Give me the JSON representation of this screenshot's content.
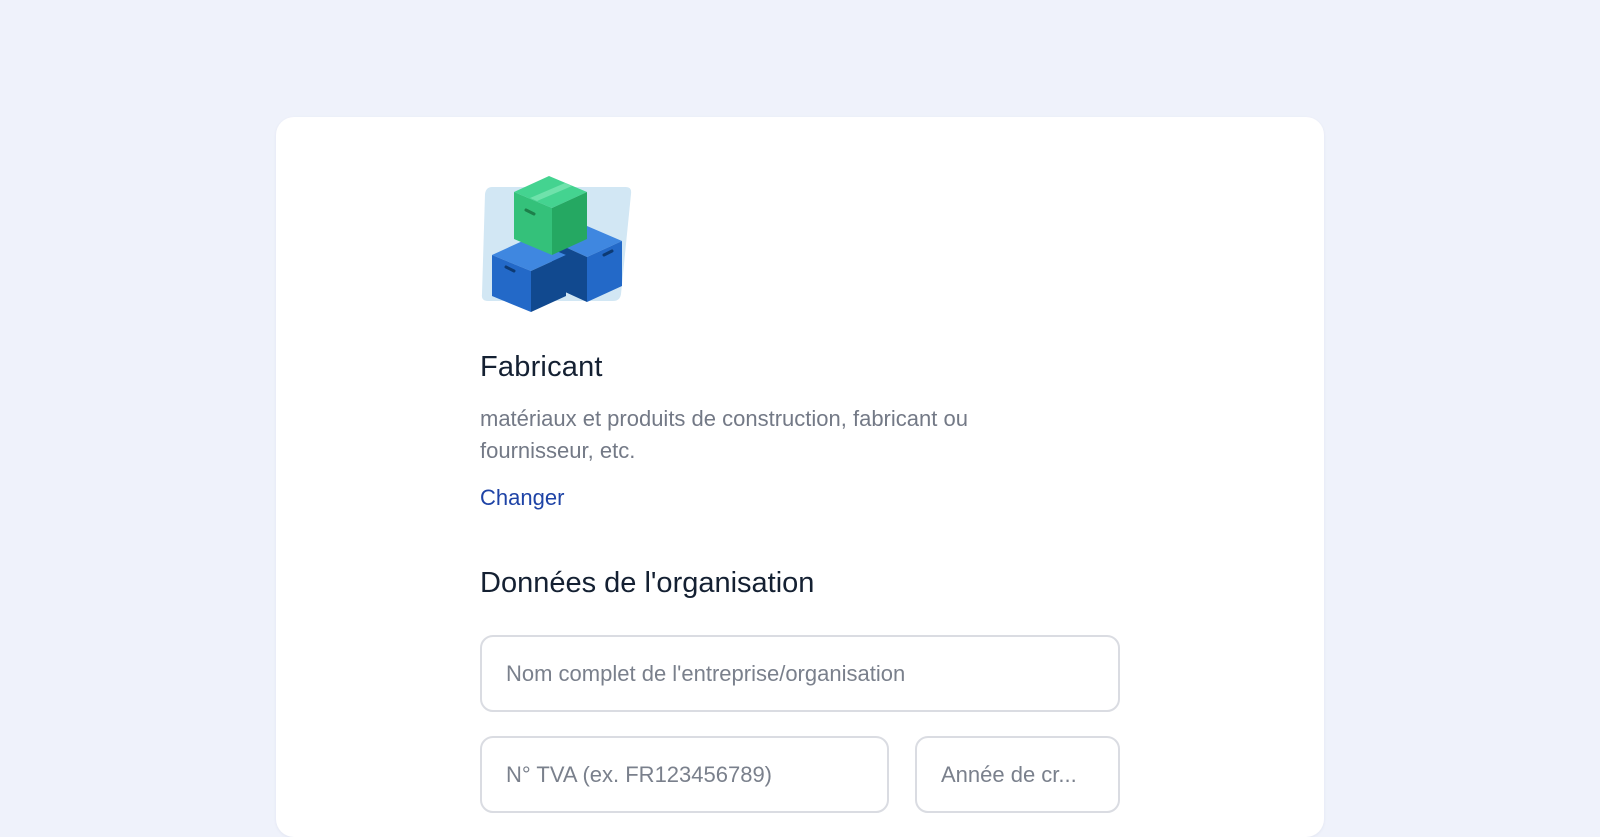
{
  "category": {
    "icon": "stacked-boxes-icon",
    "title": "Fabricant",
    "description": "matériaux et produits de construction, fabricant ou fournisseur, etc.",
    "change_label": "Changer"
  },
  "organization": {
    "section_title": "Données de l'organisation",
    "name_placeholder": "Nom complet de l'entreprise/organisation",
    "tva_placeholder": "N° TVA (ex. FR123456789)",
    "year_placeholder": "Année de cr..."
  },
  "colors": {
    "page_background": "#eff2fb",
    "card_background": "#ffffff",
    "heading": "#142032",
    "muted_text": "#737986",
    "link": "#1e43a6",
    "box_green": "#34c17a",
    "box_blue": "#2369c8"
  }
}
